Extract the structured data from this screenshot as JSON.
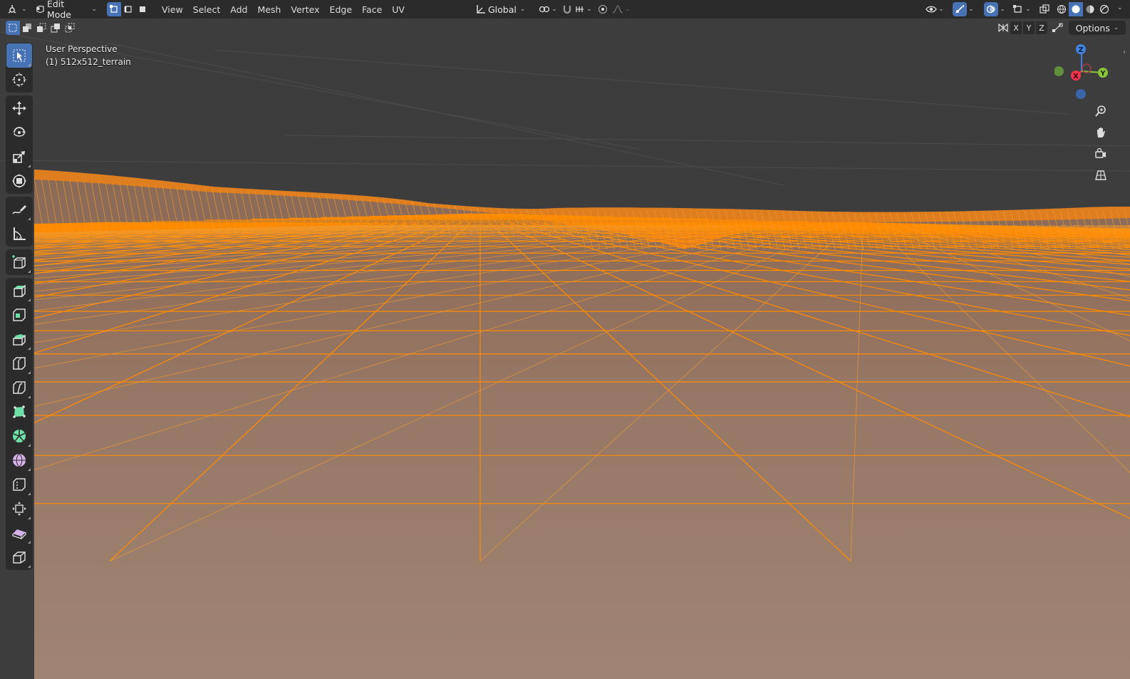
{
  "header": {
    "mode": {
      "label": "Edit Mode"
    },
    "menus": [
      "View",
      "Select",
      "Add",
      "Mesh",
      "Vertex",
      "Edge",
      "Face",
      "UV"
    ],
    "transform_orientation": "Global",
    "select_modes": [
      "vertex",
      "edge",
      "face"
    ],
    "active_select_mode": "vertex"
  },
  "subheader": {
    "axes": [
      "X",
      "Y",
      "Z"
    ],
    "options_label": "Options"
  },
  "viewport": {
    "view_name": "User Perspective",
    "object_name": "(1) 512x512_terrain"
  },
  "gizmo": {
    "labels": {
      "z": "Z",
      "x": "X",
      "y": "Y"
    },
    "colors": {
      "x": "#f0344e",
      "y": "#8bc43a",
      "z": "#3e84e0",
      "neg_y": "#5e8f3a",
      "neg_z": "#3a66a8"
    }
  },
  "toolbar": {
    "tools": [
      "select-box",
      "cursor",
      "move",
      "rotate",
      "scale",
      "transform",
      "annotate",
      "measure",
      "add-cube",
      "extrude-region",
      "inset-faces",
      "bevel",
      "loop-cut",
      "knife",
      "poly-build",
      "spin",
      "smooth",
      "edge-slide",
      "shrink-fatten",
      "shear",
      "rip-region"
    ],
    "active_tool": "select-box"
  },
  "colors": {
    "accent": "#4772b3",
    "sky": "#3d3d3d",
    "terrain_face": "#9c7b66",
    "wire": "#ff8a00"
  }
}
